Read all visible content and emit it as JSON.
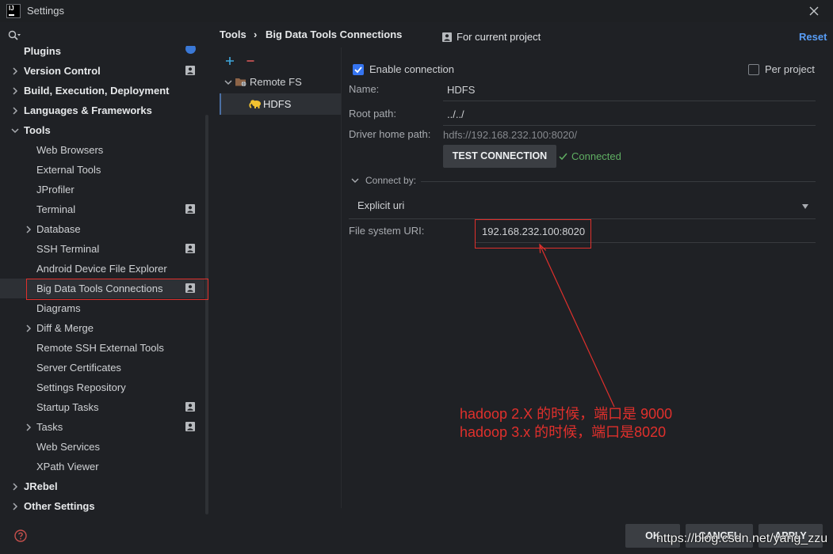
{
  "window": {
    "logo": "IJ",
    "title": "Settings",
    "close_icon": "close-icon"
  },
  "sidebar": {
    "search": {
      "placeholder": "",
      "value": "",
      "icon": "search-icon"
    },
    "items": [
      {
        "label": "Plugins",
        "badge": "update-badge-icon"
      },
      {
        "label": "Version Control",
        "expanded": false,
        "icon": "project-icon"
      },
      {
        "label": "Build, Execution, Deployment",
        "expanded": false
      },
      {
        "label": "Languages & Frameworks",
        "expanded": false
      },
      {
        "label": "Tools",
        "expanded": true,
        "children": [
          {
            "label": "Web Browsers"
          },
          {
            "label": "External Tools"
          },
          {
            "label": "JProfiler"
          },
          {
            "label": "Terminal",
            "icon": "project-icon"
          },
          {
            "label": "Database",
            "expanded": false
          },
          {
            "label": "SSH Terminal",
            "icon": "project-icon"
          },
          {
            "label": "Android Device File Explorer"
          },
          {
            "label": "Big Data Tools Connections",
            "icon": "project-icon",
            "selected": true
          },
          {
            "label": "Diagrams"
          },
          {
            "label": "Diff & Merge",
            "expanded": false
          },
          {
            "label": "Remote SSH External Tools"
          },
          {
            "label": "Server Certificates"
          },
          {
            "label": "Settings Repository"
          },
          {
            "label": "Startup Tasks",
            "icon": "project-icon"
          },
          {
            "label": "Tasks",
            "expanded": false,
            "icon": "project-icon"
          },
          {
            "label": "Web Services"
          },
          {
            "label": "XPath Viewer"
          }
        ]
      },
      {
        "label": "JRebel",
        "expanded": false
      },
      {
        "label": "Other Settings",
        "expanded": false
      }
    ]
  },
  "header": {
    "breadcrumb": {
      "parent": "Tools",
      "separator": "›",
      "current": "Big Data Tools Connections"
    },
    "scope": "For current project",
    "scope_icon": "project-icon",
    "reset": "Reset"
  },
  "connections": {
    "toolbar": {
      "add_icon": "plus-icon",
      "remove_icon": "minus-icon"
    },
    "groups": [
      {
        "label": "Remote FS",
        "icon": "remote-fs-icon",
        "expanded": true,
        "children": [
          {
            "label": "HDFS",
            "icon": "hadoop-elephant-icon",
            "selected": true
          }
        ]
      }
    ]
  },
  "form": {
    "enable_connection": {
      "label": "Enable connection",
      "checked": true
    },
    "per_project": {
      "label": "Per project",
      "checked": false
    },
    "name": {
      "label": "Name:",
      "value": "HDFS"
    },
    "root_path": {
      "label": "Root path:",
      "value": "../../"
    },
    "driver_home_path": {
      "label": "Driver home path:",
      "value": "hdfs://192.168.232.100:8020/"
    },
    "test_connection": "TEST CONNECTION",
    "status": {
      "text": "Connected",
      "icon": "check-icon"
    },
    "connect_by": {
      "label": "Connect by:",
      "expanded": true,
      "selected": "Explicit uri"
    },
    "file_system_uri": {
      "label": "File system URI:",
      "value": "192.168.232.100:8020"
    }
  },
  "annotation": {
    "lines": [
      "hadoop 2.X 的时候，端口是 9000",
      "hadoop 3.x 的时候，端口是8020"
    ]
  },
  "footer": {
    "ok": "OK",
    "cancel": "CANCEL",
    "apply": "APPLY",
    "help_icon": "help-icon"
  },
  "watermark": "https://blog.csdn.net/yang_zzu",
  "colors": {
    "accent": "#3574f0",
    "link": "#589df6",
    "success": "#5fae62",
    "annotation": "#e0302c",
    "background": "#1f2125"
  }
}
